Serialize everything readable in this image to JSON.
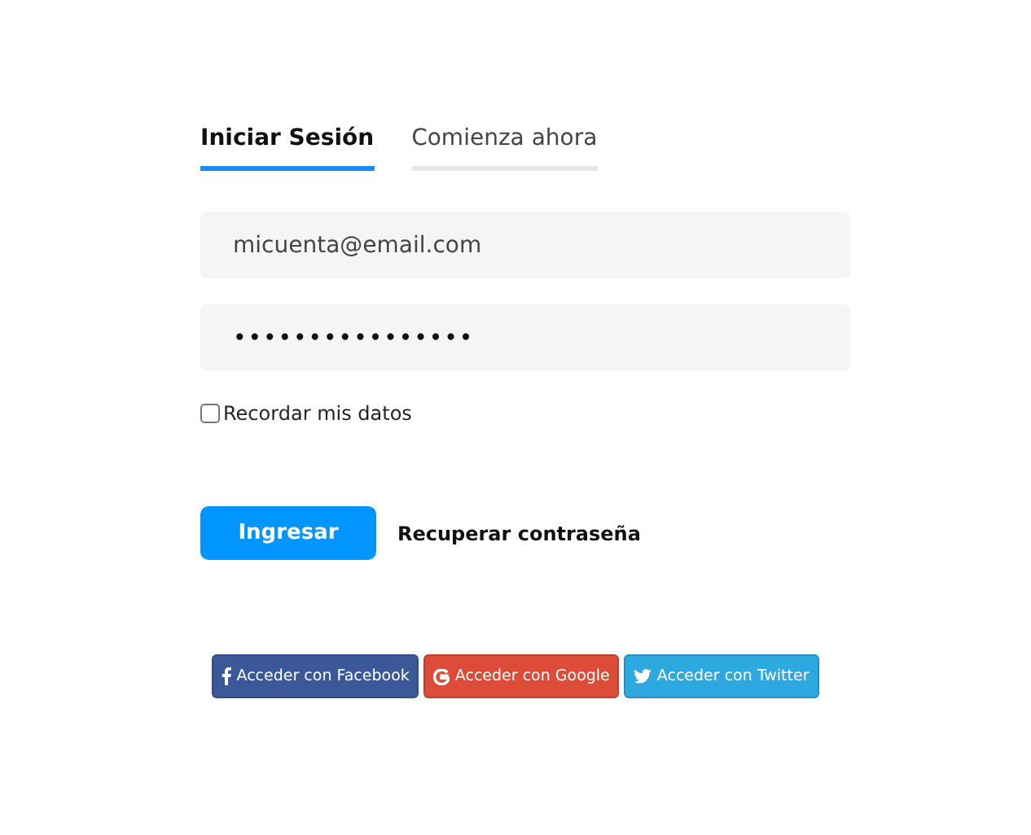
{
  "tabs": [
    {
      "label": "Iniciar Sesión",
      "selected": true
    },
    {
      "label": "Comienza ahora",
      "selected": false
    }
  ],
  "email": {
    "value": "micuenta@email.com"
  },
  "password": {
    "value": "••••••••••••••••"
  },
  "remember": {
    "label": "Recordar mis datos",
    "checked": false
  },
  "submit": {
    "label": "Ingresar"
  },
  "recover": {
    "label": "Recuperar contraseña"
  },
  "social": [
    {
      "kind": "facebook",
      "label": "Acceder con Facebook",
      "color": "#3b5998"
    },
    {
      "kind": "google",
      "label": "Acceder con Google",
      "color": "#dd4b39"
    },
    {
      "kind": "twitter",
      "label": "Acceder con Twitter",
      "color": "#2ea8e1"
    }
  ]
}
